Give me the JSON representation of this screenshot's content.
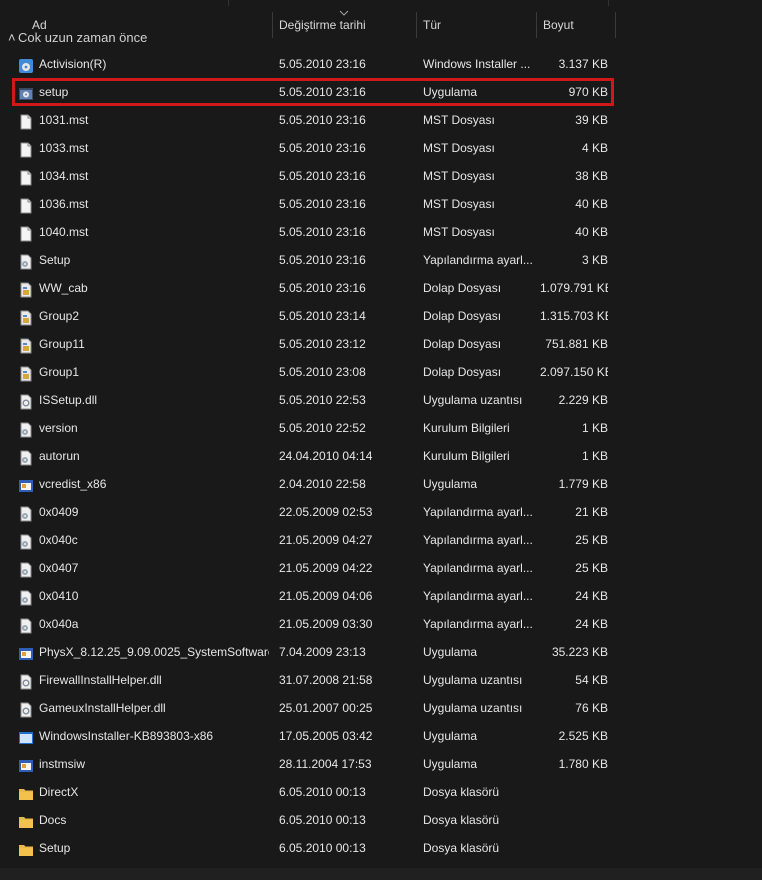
{
  "columns": {
    "name": "Ad",
    "date": "Değiştirme tarihi",
    "type": "Tür",
    "size": "Boyut"
  },
  "group_label": "Çok uzun zaman önce",
  "files": [
    {
      "name": "Activision(R)",
      "date": "5.05.2010 23:16",
      "type": "Windows Installer ...",
      "size": "3.137 KB",
      "icon": "installer-icon"
    },
    {
      "name": "setup",
      "date": "5.05.2010 23:16",
      "type": "Uygulama",
      "size": "970 KB",
      "icon": "setup-app-icon",
      "selected": true
    },
    {
      "name": "1031.mst",
      "date": "5.05.2010 23:16",
      "type": "MST Dosyası",
      "size": "39 KB",
      "icon": "file-icon"
    },
    {
      "name": "1033.mst",
      "date": "5.05.2010 23:16",
      "type": "MST Dosyası",
      "size": "4 KB",
      "icon": "file-icon"
    },
    {
      "name": "1034.mst",
      "date": "5.05.2010 23:16",
      "type": "MST Dosyası",
      "size": "38 KB",
      "icon": "file-icon"
    },
    {
      "name": "1036.mst",
      "date": "5.05.2010 23:16",
      "type": "MST Dosyası",
      "size": "40 KB",
      "icon": "file-icon"
    },
    {
      "name": "1040.mst",
      "date": "5.05.2010 23:16",
      "type": "MST Dosyası",
      "size": "40 KB",
      "icon": "file-icon"
    },
    {
      "name": "Setup",
      "date": "5.05.2010 23:16",
      "type": "Yapılandırma ayarl...",
      "size": "3 KB",
      "icon": "config-icon"
    },
    {
      "name": "WW_cab",
      "date": "5.05.2010 23:16",
      "type": "Dolap Dosyası",
      "size": "1.079.791 KB",
      "icon": "cab-icon"
    },
    {
      "name": "Group2",
      "date": "5.05.2010 23:14",
      "type": "Dolap Dosyası",
      "size": "1.315.703 KB",
      "icon": "cab-icon"
    },
    {
      "name": "Group11",
      "date": "5.05.2010 23:12",
      "type": "Dolap Dosyası",
      "size": "751.881 KB",
      "icon": "cab-icon"
    },
    {
      "name": "Group1",
      "date": "5.05.2010 23:08",
      "type": "Dolap Dosyası",
      "size": "2.097.150 KB",
      "icon": "cab-icon"
    },
    {
      "name": "ISSetup.dll",
      "date": "5.05.2010 22:53",
      "type": "Uygulama uzantısı",
      "size": "2.229 KB",
      "icon": "dll-icon"
    },
    {
      "name": "version",
      "date": "5.05.2010 22:52",
      "type": "Kurulum Bilgileri",
      "size": "1 KB",
      "icon": "config-icon"
    },
    {
      "name": "autorun",
      "date": "24.04.2010 04:14",
      "type": "Kurulum Bilgileri",
      "size": "1 KB",
      "icon": "config-icon"
    },
    {
      "name": "vcredist_x86",
      "date": "2.04.2010 22:58",
      "type": "Uygulama",
      "size": "1.779 KB",
      "icon": "app-icon"
    },
    {
      "name": "0x0409",
      "date": "22.05.2009 02:53",
      "type": "Yapılandırma ayarl...",
      "size": "21 KB",
      "icon": "config-icon"
    },
    {
      "name": "0x040c",
      "date": "21.05.2009 04:27",
      "type": "Yapılandırma ayarl...",
      "size": "25 KB",
      "icon": "config-icon"
    },
    {
      "name": "0x0407",
      "date": "21.05.2009 04:22",
      "type": "Yapılandırma ayarl...",
      "size": "25 KB",
      "icon": "config-icon"
    },
    {
      "name": "0x0410",
      "date": "21.05.2009 04:06",
      "type": "Yapılandırma ayarl...",
      "size": "24 KB",
      "icon": "config-icon"
    },
    {
      "name": "0x040a",
      "date": "21.05.2009 03:30",
      "type": "Yapılandırma ayarl...",
      "size": "24 KB",
      "icon": "config-icon"
    },
    {
      "name": "PhysX_8.12.25_9.09.0025_SystemSoftware",
      "date": "7.04.2009 23:13",
      "type": "Uygulama",
      "size": "35.223 KB",
      "icon": "app-icon"
    },
    {
      "name": "FirewallInstallHelper.dll",
      "date": "31.07.2008 21:58",
      "type": "Uygulama uzantısı",
      "size": "54 KB",
      "icon": "dll-icon"
    },
    {
      "name": "GameuxInstallHelper.dll",
      "date": "25.01.2007 00:25",
      "type": "Uygulama uzantısı",
      "size": "76 KB",
      "icon": "dll-icon"
    },
    {
      "name": "WindowsInstaller-KB893803-x86",
      "date": "17.05.2005 03:42",
      "type": "Uygulama",
      "size": "2.525 KB",
      "icon": "window-app-icon"
    },
    {
      "name": "instmsiw",
      "date": "28.11.2004 17:53",
      "type": "Uygulama",
      "size": "1.780 KB",
      "icon": "app-icon"
    },
    {
      "name": "DirectX",
      "date": "6.05.2010 00:13",
      "type": "Dosya klasörü",
      "size": "",
      "icon": "folder-icon"
    },
    {
      "name": "Docs",
      "date": "6.05.2010 00:13",
      "type": "Dosya klasörü",
      "size": "",
      "icon": "folder-icon"
    },
    {
      "name": "Setup",
      "date": "6.05.2010 00:13",
      "type": "Dosya klasörü",
      "size": "",
      "icon": "folder-icon"
    }
  ],
  "colors": {
    "background": "#191919",
    "text": "#e6e6e6",
    "selection_outline": "#d0181b",
    "folder": "#f2c14e"
  }
}
